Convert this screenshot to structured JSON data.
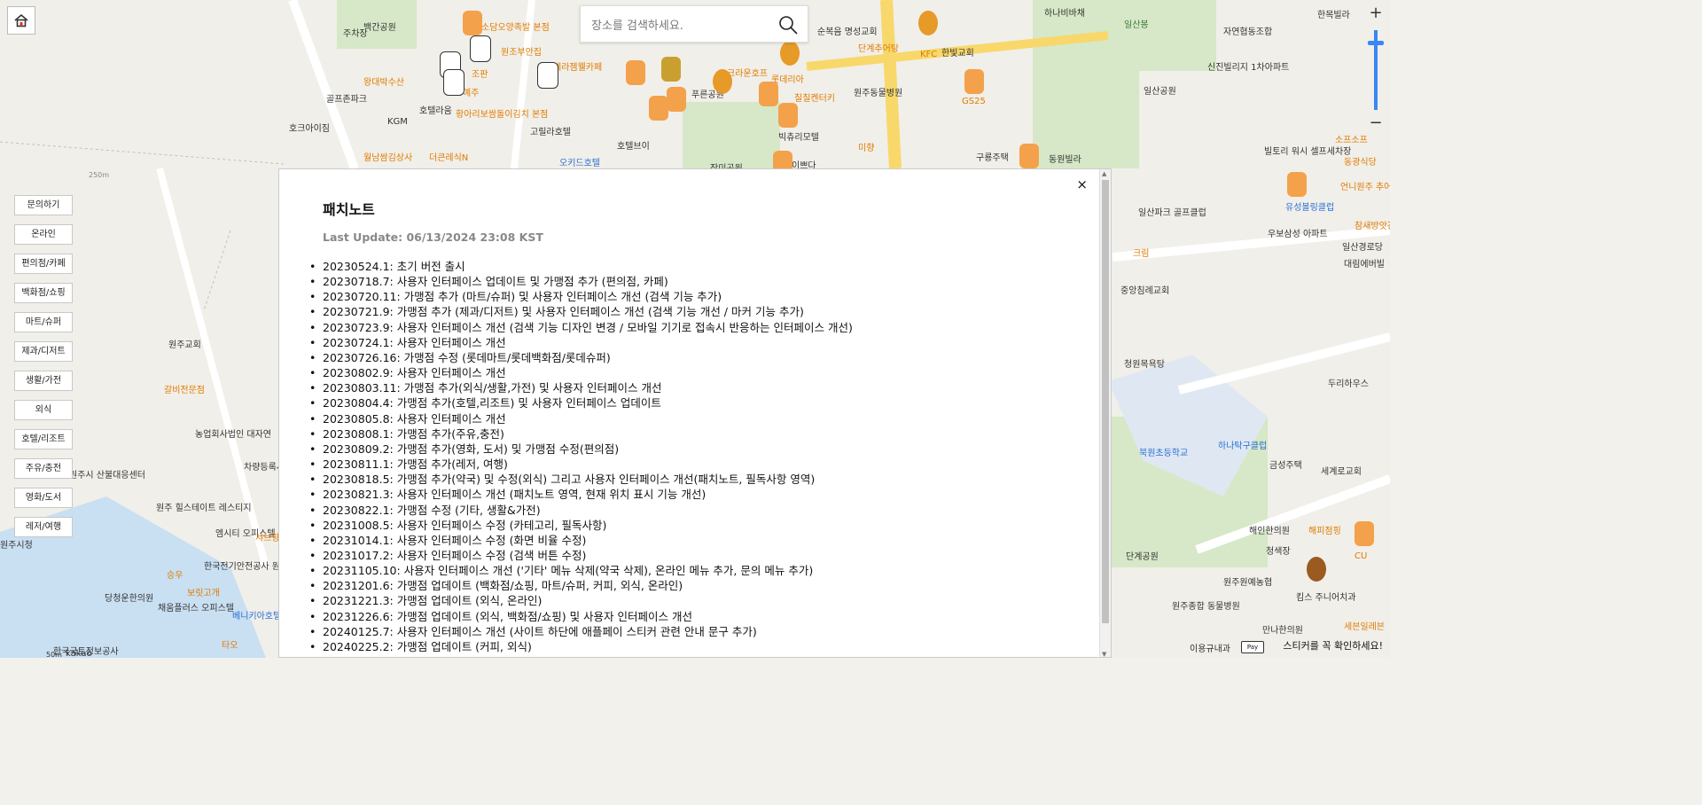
{
  "search": {
    "placeholder": "장소를 검색하세요."
  },
  "categories": [
    "문의하기",
    "온라인",
    "편의점/카페",
    "백화점/쇼핑",
    "마트/슈퍼",
    "제과/디저트",
    "생활/가전",
    "외식",
    "호텔/리조트",
    "주유/충전",
    "영화/도서",
    "레저/여행"
  ],
  "zoom": {
    "in": "+",
    "out": "−"
  },
  "modal": {
    "close": "×",
    "title": "패치노트",
    "last_update": "Last Update: 06/13/2024 23:08 KST",
    "notes": [
      "20230524.1: 초기 버전 출시",
      "20230718.7: 사용자 인터페이스 업데이트 및 가맹점 추가 (편의점, 카페)",
      "20230720.11: 가맹점 추가 (마트/슈퍼) 및 사용자 인터페이스 개선 (검색 기능 추가)",
      "20230721.9: 가맹점 추가 (제과/디저트) 및 사용자 인터페이스 개선 (검색 기능 개선 / 마커 기능 추가)",
      "20230723.9: 사용자 인터페이스 개선 (검색 기능 디자인 변경 / 모바일 기기로 접속시 반응하는 인터페이스 개선)",
      "20230724.1: 사용자 인터페이스 개선",
      "20230726.16: 가맹점 수정 (롯데마트/롯데백화점/롯데슈퍼)",
      "20230802.9: 사용자 인터페이스 개선",
      "20230803.11: 가맹점 추가(외식/생활,가전) 및 사용자 인터페이스 개선",
      "20230804.4: 가맹점 추가(호텔,리조트) 및 사용자 인터페이스 업데이트",
      "20230805.8: 사용자 인터페이스 개선",
      "20230808.1: 가맹점 추가(주유,충전)",
      "20230809.2: 가맹점 추가(영화, 도서) 및 가맹점 수정(편의점)",
      "20230811.1: 가맹점 추가(레저, 여행)",
      "20230818.5: 가맹점 추가(약국) 및 수정(외식) 그리고 사용자 인터페이스 개선(패치노트, 필독사항 영역)",
      "20230821.3: 사용자 인터페이스 개선 (패치노트 영역, 현재 위치 표시 기능 개선)",
      "20230822.1: 가맹점 수정 (기타, 생활&가전)",
      "20231008.5: 사용자 인터페이스 수정 (카테고리, 필독사항)",
      "20231014.1: 사용자 인터페이스 수정 (화면 비율 수정)",
      "20231017.2: 사용자 인터페이스 수정 (검색 버튼 수정)",
      "20231105.10: 사용자 인터페이스 개선 ('기타' 메뉴 삭제(약국 삭제), 온라인 메뉴 추가, 문의 메뉴 추가)",
      "20231201.6: 가맹점 업데이트 (백화점/쇼핑, 마트/슈퍼, 커피, 외식, 온라인)",
      "20231221.3: 가맹점 업데이트 (외식, 온라인)",
      "20231226.6: 가맹점 업데이트 (외식, 백화점/쇼핑) 및 사용자 인터페이스 개선",
      "20240125.7: 사용자 인터페이스 개선 (사이트 하단에 애플페이 스티커 관련 안내 문구 추가)",
      "20240225.2: 가맹점 업데이트 (커피, 외식)"
    ]
  },
  "footer": {
    "notice": "스티커를 꼭 확인하세요!",
    "applepay": "Pay"
  },
  "map_labels": [
    "백간공원",
    "주차장",
    "소담오양족발 본점",
    "원조부안집",
    "세라젬웰카페",
    "크라운호프",
    "롯데리아",
    "칠칠켄터키",
    "순복음 명성교회",
    "단계추어탕",
    "KFC",
    "한빛교회",
    "하나비바채",
    "일산봉",
    "자연협동조합",
    "신진빌리지 1차아파트",
    "한목빌라",
    "왕대박수산",
    "조판",
    "예주",
    "골프존파크",
    "호텔라움",
    "KGM",
    "황아리보쌈돌이김치 본점",
    "고릴라호텔",
    "호텔브이",
    "푸른공원",
    "빅츄리모텔",
    "원주동물병원",
    "미향",
    "GS25",
    "일산공원",
    "소프소프",
    "빌토리 워시 셀프세차장",
    "동광식당",
    "호크아이짐",
    "월남쌈김상사",
    "더큰레식N",
    "오키드호텔",
    "장미공원",
    "이쁘다",
    "구룡주택",
    "동원빌라",
    "일산파크 골프클럽",
    "우보삼성 아파트",
    "유성볼링클럽",
    "언니원주 추어탕",
    "참새방앗간",
    "일산경로당",
    "대림에버빌",
    "크림",
    "중앙침례교회",
    "청원목욕탕",
    "두리하우스",
    "원주교회",
    "갈비전문점",
    "농업회사법인 대자연",
    "원주시 산불대응센터",
    "차량등록사업소",
    "원주 힐스테이트 레스티지",
    "엠시티 오피스텔",
    "샤브향",
    "한국전기안전공사 원주지사",
    "승우",
    "보릿고개",
    "당청운한의원",
    "채움플러스 오피스텔",
    "베니키아호텔 비즈인",
    "타오",
    "원주시청",
    "한국국토정보공사",
    "북원초등학교",
    "하나탁구클럽",
    "금성주택",
    "세계로교회",
    "해인한의원",
    "해피점핑",
    "청색장",
    "단계공원",
    "원주원예농협",
    "원주종합 동물병원",
    "킴스 주니어치과",
    "만나한의원",
    "이용규내과",
    "세븐일레븐",
    "CU",
    "kakao",
    "50m",
    "250m"
  ]
}
